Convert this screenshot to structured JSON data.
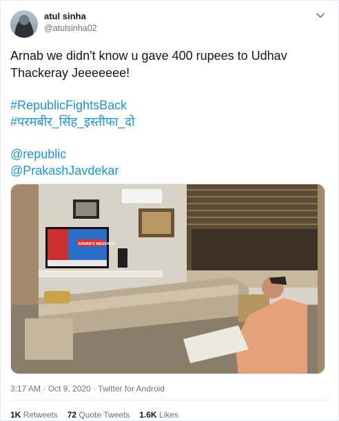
{
  "tweet": {
    "author_name": "atul sinha",
    "author_handle": "@atulsinha02",
    "text_line1": "Arnab we didn't know u gave 400 rupees to Udhav",
    "text_line2": "Thackeray Jeeeeeee!",
    "hashtag1": "#RepublicFightsBack",
    "hashtag2": "#परमबीर_सिंह_इस्तीफा_दो",
    "mention1": "@republic",
    "mention2": "@PrakashJavdekar",
    "tv_caption": "ARNAB'S MESSAGE",
    "timestamp": "3:17 AM · Oct 9, 2020 · Twitter for Android",
    "stats": {
      "retweets_count": "1K",
      "retweets_label": "Retweets",
      "quotes_count": "72",
      "quotes_label": "Quote Tweets",
      "likes_count": "1.6K",
      "likes_label": "Likes"
    }
  },
  "colors": {
    "link": "#1b95e0",
    "secondary_text": "#657786",
    "divider": "#e6ecf0"
  },
  "icons": {
    "caret": "chevron-down-icon",
    "avatar": "avatar"
  }
}
